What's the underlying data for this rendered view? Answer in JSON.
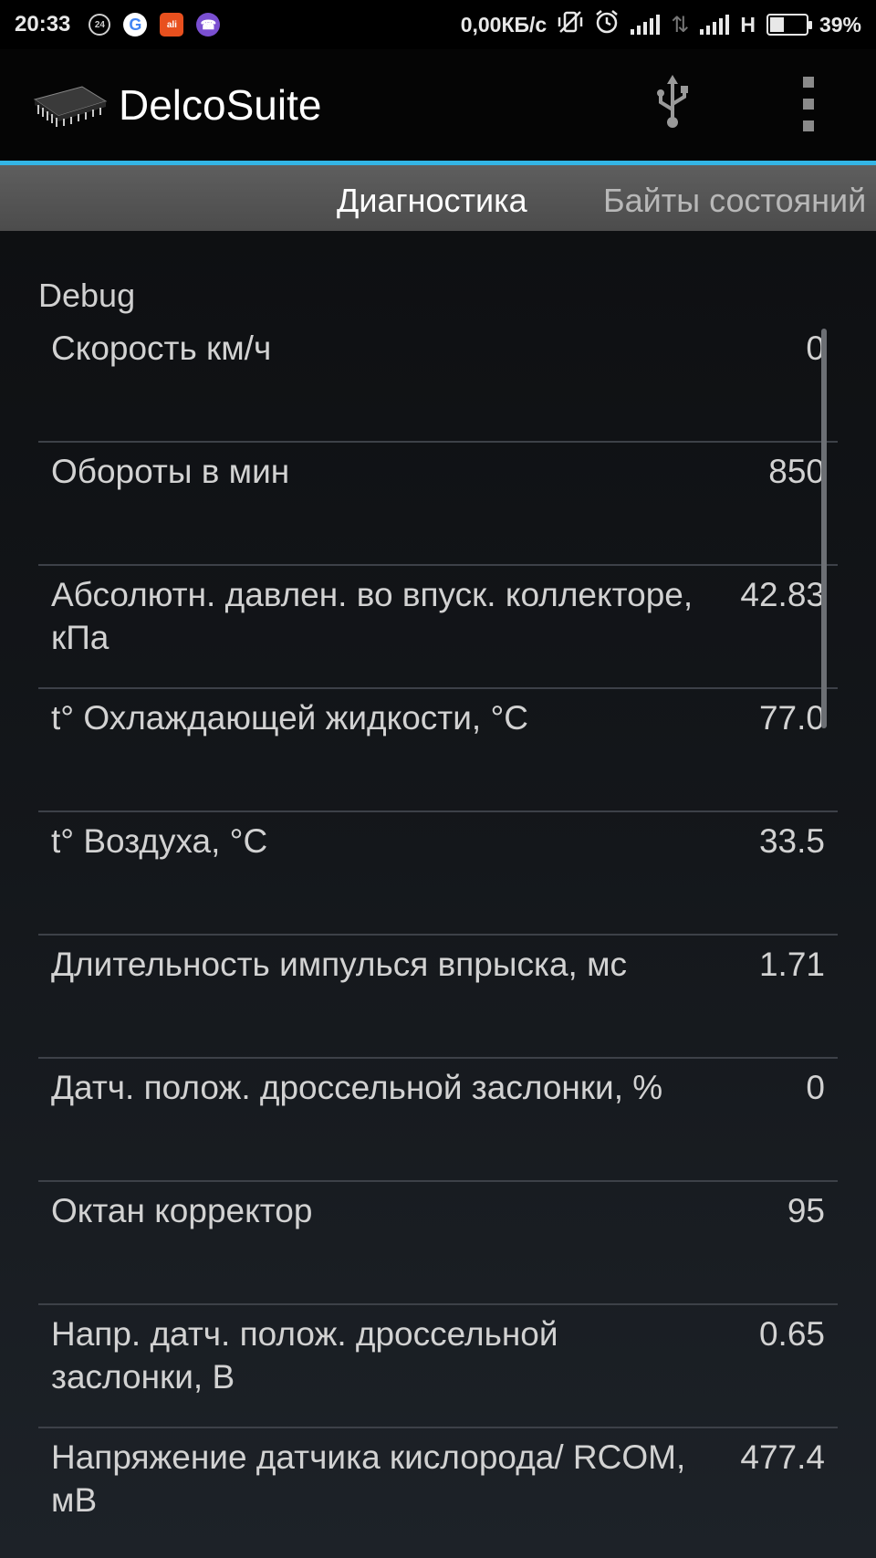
{
  "statusbar": {
    "time": "20:33",
    "notif_24": "24",
    "notif_google": "G",
    "notif_ali": "ali",
    "notif_viber": "☎",
    "speed": "0,00КБ/с",
    "network_type": "H",
    "battery_percent": "39%",
    "battery_level": 0.39,
    "icons": [
      "vibrate-off-icon",
      "alarm-icon",
      "signal-icon",
      "data-arrows-icon",
      "signal-icon",
      "battery-icon"
    ]
  },
  "actionbar": {
    "title": "DelcoSuite",
    "icons": [
      "chip-icon",
      "usb-icon",
      "overflow-menu-icon"
    ]
  },
  "tabs": [
    {
      "label": "Диагностика",
      "active": true
    },
    {
      "label": "Байты состояний",
      "active": false
    }
  ],
  "section": {
    "title": "Debug"
  },
  "rows": [
    {
      "label": "Скорость км/ч",
      "value": "0"
    },
    {
      "label": "Обороты в мин",
      "value": "850"
    },
    {
      "label": "Абсолютн. давлен. во впуск. коллекторе, кПа",
      "value": "42.83"
    },
    {
      "label": "t° Охлаждающей жидкости, °C",
      "value": "77.0"
    },
    {
      "label": "t° Воздуха, °C",
      "value": "33.5"
    },
    {
      "label": "Длительность импулься впрыска, мс",
      "value": "1.71"
    },
    {
      "label": "Датч. полож. дроссельной заслонки, %",
      "value": "0"
    },
    {
      "label": "Октан корректор",
      "value": "95"
    },
    {
      "label": "Напр. датч. полож. дроссельной заслонки, В",
      "value": "0.65"
    },
    {
      "label": "Напряжение датчика кислорода/ RCOM, мВ",
      "value": "477.4"
    }
  ],
  "colors": {
    "accent": "#33b5e5",
    "tabbar": "#555555",
    "background": "#101216"
  }
}
